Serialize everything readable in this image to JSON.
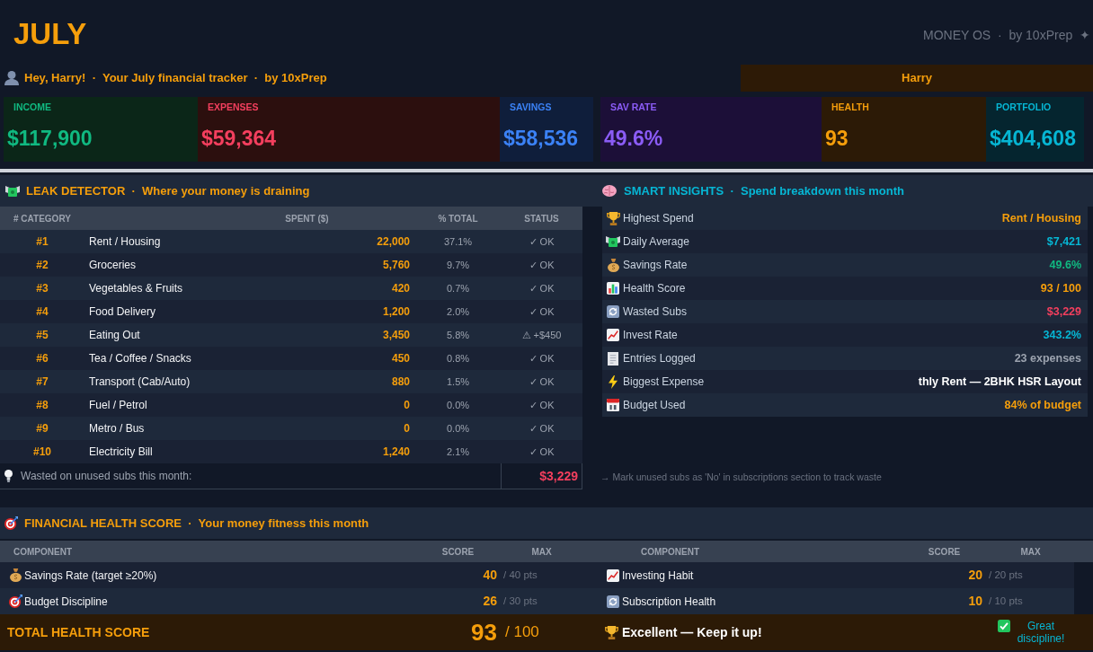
{
  "header": {
    "title": "JULY",
    "brand": "MONEY OS  ·  by 10xPrep  ✦"
  },
  "greeting": {
    "text": "Hey, Harry!  ·  Your July financial tracker  ·  by 10xPrep",
    "name": "Harry"
  },
  "kpis": [
    {
      "label": "INCOME",
      "value": "$117,900",
      "color": "#10b981"
    },
    {
      "label": "EXPENSES",
      "value": "$59,364",
      "color": "#f43f5e"
    },
    {
      "label": "SAVINGS",
      "value": "$58,536",
      "color": "#3b82f6"
    },
    {
      "label": "SAV RATE",
      "value": "49.6%",
      "color": "#8b5cf6"
    },
    {
      "label": "HEALTH",
      "value": "93",
      "color": "#f59e0b"
    },
    {
      "label": "PORTFOLIO",
      "value": "$404,608",
      "color": "#06b6d4"
    }
  ],
  "leak_detector": {
    "heading": "LEAK DETECTOR  ·  Where your money is draining",
    "columns": [
      "# CATEGORY",
      "SPENT ($)",
      "% TOTAL",
      "STATUS"
    ],
    "rows": [
      {
        "rank": "#1",
        "category": "Rent / Housing",
        "spent": "22,000",
        "share": "37.1%",
        "status": "✓ OK"
      },
      {
        "rank": "#2",
        "category": "Groceries",
        "spent": "5,760",
        "share": "9.7%",
        "status": "✓ OK"
      },
      {
        "rank": "#3",
        "category": "Vegetables & Fruits",
        "spent": "420",
        "share": "0.7%",
        "status": "✓ OK"
      },
      {
        "rank": "#4",
        "category": "Food Delivery",
        "spent": "1,200",
        "share": "2.0%",
        "status": "✓ OK"
      },
      {
        "rank": "#5",
        "category": "Eating Out",
        "spent": "3,450",
        "share": "5.8%",
        "status": "⚠ +$450"
      },
      {
        "rank": "#6",
        "category": "Tea / Coffee / Snacks",
        "spent": "450",
        "share": "0.8%",
        "status": "✓ OK"
      },
      {
        "rank": "#7",
        "category": "Transport (Cab/Auto)",
        "spent": "880",
        "share": "1.5%",
        "status": "✓ OK"
      },
      {
        "rank": "#8",
        "category": "Fuel / Petrol",
        "spent": "0",
        "share": "0.0%",
        "status": "✓ OK"
      },
      {
        "rank": "#9",
        "category": "Metro / Bus",
        "spent": "0",
        "share": "0.0%",
        "status": "✓ OK"
      },
      {
        "rank": "#10",
        "category": "Electricity Bill",
        "spent": "1,240",
        "share": "2.1%",
        "status": "✓ OK"
      }
    ],
    "footer": {
      "label": "Wasted on unused subs this month:",
      "amount": "$3,229"
    }
  },
  "smart_insights": {
    "heading": "SMART INSIGHTS  ·  Spend breakdown this month",
    "rows": [
      {
        "label": "Highest Spend",
        "value": "Rent / Housing",
        "color": "#f59e0b"
      },
      {
        "label": "Daily Average",
        "value": "$7,421",
        "color": "#06b6d4"
      },
      {
        "label": "Savings Rate",
        "value": "49.6%",
        "color": "#10b981"
      },
      {
        "label": "Health Score",
        "value": "93 / 100",
        "color": "#f59e0b"
      },
      {
        "label": "Wasted Subs",
        "value": "$3,229",
        "color": "#f43f5e"
      },
      {
        "label": "Invest Rate",
        "value": "343.2%",
        "color": "#06b6d4"
      },
      {
        "label": "Entries Logged",
        "value": "23 expenses",
        "color": "#9ca3af"
      },
      {
        "label": "Biggest Expense",
        "value": "thly Rent — 2BHK HSR Layout",
        "color": "#ffffff"
      },
      {
        "label": "Budget Used",
        "value": "84% of budget",
        "color": "#f59e0b"
      }
    ],
    "note": "→ Mark unused subs as 'No' in subscriptions section to track waste"
  },
  "health_score": {
    "heading": "FINANCIAL HEALTH SCORE  ·  Your money fitness this month",
    "tables": [
      {
        "columns": [
          "COMPONENT",
          "SCORE",
          "MAX"
        ],
        "rows": [
          {
            "label": "Savings Rate (target ≥20%)",
            "score": "40",
            "max": "/ 40 pts"
          },
          {
            "label": "Budget Discipline",
            "score": "26",
            "max": "/ 30 pts"
          }
        ]
      },
      {
        "columns": [
          "COMPONENT",
          "SCORE",
          "MAX"
        ],
        "rows": [
          {
            "label": "Investing Habit",
            "score": "20",
            "max": "/ 20 pts"
          },
          {
            "label": "Subscription Health",
            "score": "10",
            "max": "/ 10 pts"
          }
        ]
      }
    ],
    "total": {
      "label": "TOTAL HEALTH SCORE",
      "score": "93",
      "out_of": "/ 100",
      "verdict": "Excellent — Keep it up!",
      "badge": "Great discipline!"
    }
  }
}
